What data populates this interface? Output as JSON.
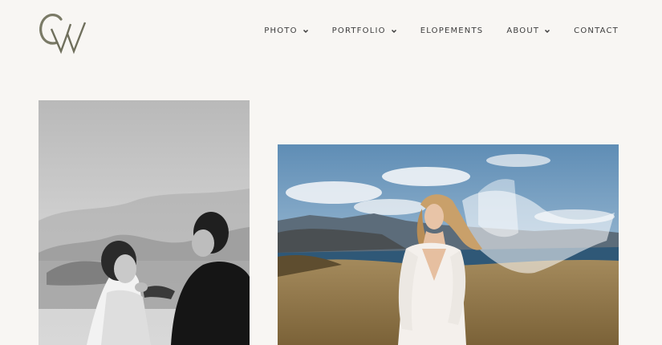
{
  "brand": {
    "logo_monogram": "GW"
  },
  "nav": {
    "items": [
      {
        "label": "PHOTO",
        "has_dropdown": true
      },
      {
        "label": "PORTFOLIO",
        "has_dropdown": true
      },
      {
        "label": "ELOPEMENTS",
        "has_dropdown": false
      },
      {
        "label": "ABOUT",
        "has_dropdown": true
      },
      {
        "label": "CONTACT",
        "has_dropdown": false
      }
    ]
  },
  "colors": {
    "background": "#f8f6f3",
    "logo": "#7a7a66",
    "nav_text": "#3d3d3d"
  },
  "gallery": {
    "images": [
      {
        "name": "couple-ceremony-photo",
        "style": "black-and-white"
      },
      {
        "name": "bride-veil-mountain-photo",
        "style": "color"
      }
    ]
  }
}
